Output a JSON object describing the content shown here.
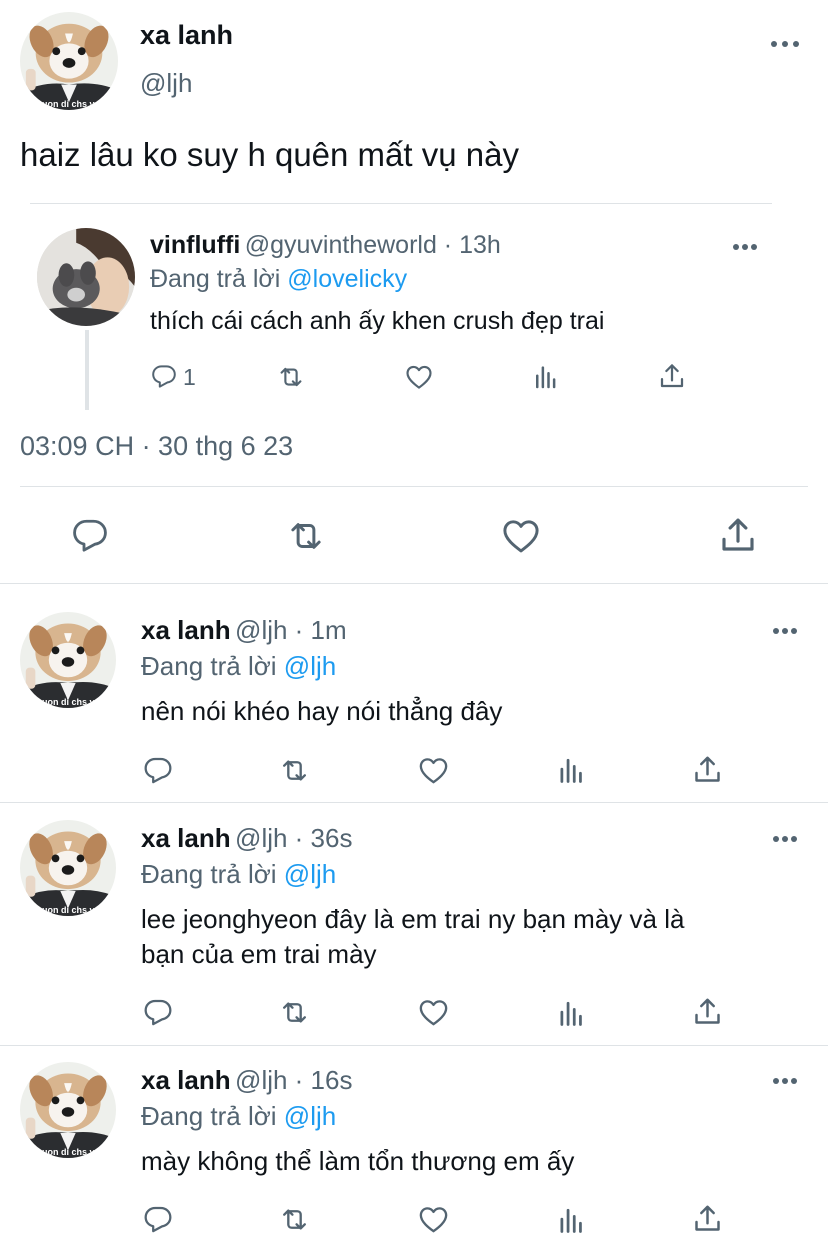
{
  "main_tweet": {
    "name": "xa lanh",
    "handle": "@ljh",
    "text": "haiz lâu ko suy h quên mất vụ này",
    "avatar_caption": "muon di chs vs t",
    "timestamp": "03:09 CH · 30 thg 6 23"
  },
  "quoted": {
    "name": "vinfluffi",
    "handle_time": "@gyuvintheworld · 13h",
    "replying_prefix": "Đang trả lời",
    "replying_to": "@lovelicky",
    "text": "thích cái cách anh ấy khen crush đẹp trai",
    "reply_count": "1"
  },
  "replies": [
    {
      "name": "xa lanh",
      "handle_time": "@ljh · 1m",
      "replying_prefix": "Đang trả lời",
      "replying_to": "@ljh",
      "text": "nên nói khéo hay nói thẳng đây",
      "avatar_caption": "muon di chs vs t"
    },
    {
      "name": "xa lanh",
      "handle_time": "@ljh · 36s",
      "replying_prefix": "Đang trả lời",
      "replying_to": "@ljh",
      "text_line1": "lee jeonghyeon đây là em trai ny bạn mày và là",
      "text_line2": "bạn của em trai mày",
      "avatar_caption": "muon di chs vs t"
    },
    {
      "name": "xa lanh",
      "handle_time": "@ljh · 16s",
      "replying_prefix": "Đang trả lời",
      "replying_to": "@ljh",
      "text": "mày không thể làm tổn thương em ấy",
      "avatar_caption": "muon di chs vs t"
    }
  ],
  "colors": {
    "accent": "#1d9bf0",
    "secondary_text": "#536471",
    "divider": "#dfe3e6"
  },
  "icons": [
    "reply-icon",
    "retweet-icon",
    "like-icon",
    "views-icon",
    "share-icon",
    "more-icon"
  ]
}
